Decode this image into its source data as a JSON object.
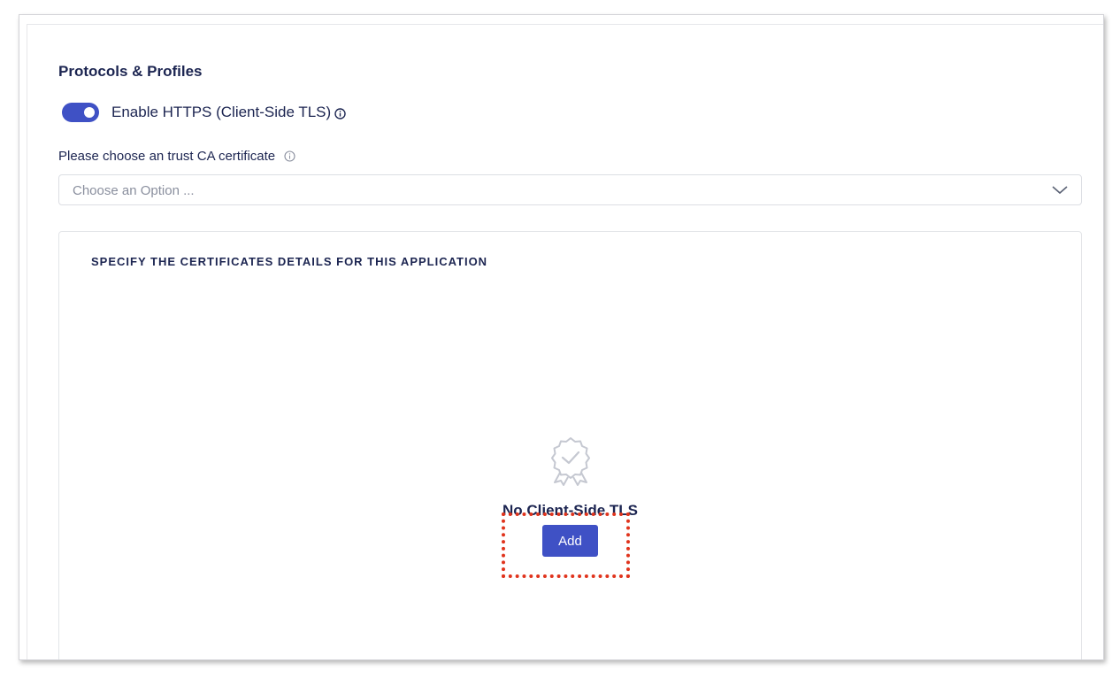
{
  "section": {
    "title": "Protocols & Profiles"
  },
  "https_toggle": {
    "label": "Enable HTTPS (Client-Side TLS)",
    "enabled": true,
    "accent_color": "#3f51c5"
  },
  "trust_ca": {
    "label": "Please choose an trust CA certificate",
    "placeholder": "Choose an Option ..."
  },
  "certificates": {
    "heading": "SPECIFY THE CERTIFICATES DETAILS FOR THIS APPLICATION",
    "empty_icon": "certificate-badge-icon",
    "empty_text": "No Client-Side TLS",
    "add_label": "Add"
  },
  "annotation": {
    "highlight_color": "#e0341d"
  }
}
